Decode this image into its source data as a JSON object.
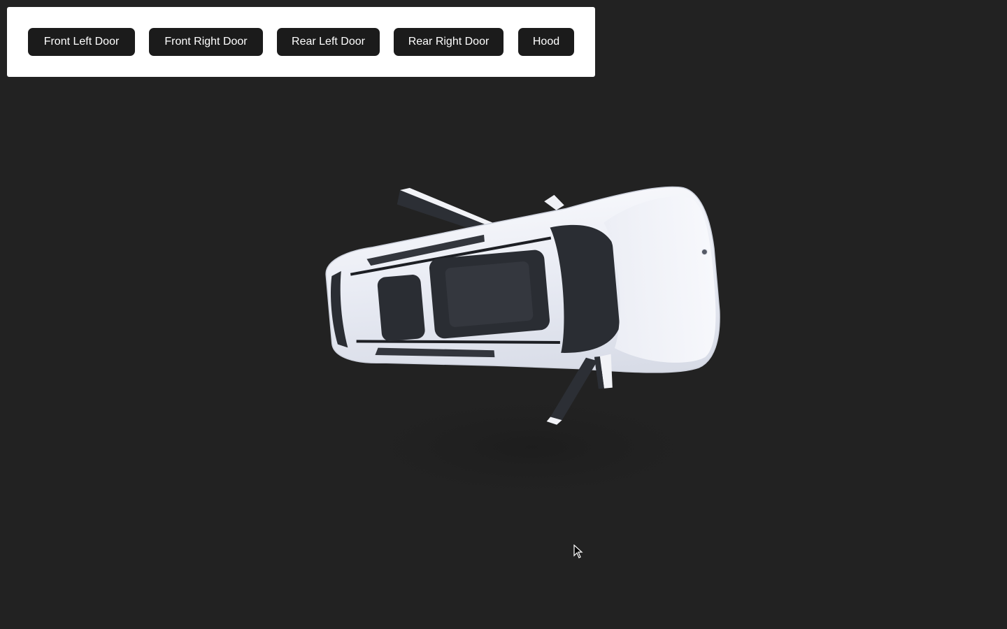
{
  "controls": {
    "buttons": [
      {
        "id": "front_left_door",
        "label": "Front Left Door"
      },
      {
        "id": "front_right_door",
        "label": "Front Right Door"
      },
      {
        "id": "rear_left_door",
        "label": "Rear Left Door"
      },
      {
        "id": "rear_right_door",
        "label": "Rear Right Door"
      },
      {
        "id": "hood",
        "label": "Hood"
      }
    ]
  },
  "scene": {
    "model": "car-3d-viewer",
    "object": "white-suv-top-view",
    "open_parts": [
      "front_left_door",
      "rear_left_door",
      "front_right_door",
      "rear_right_door"
    ],
    "colors": {
      "background": "#222222",
      "panel": "#ffffff",
      "button_bg": "#1b1b1b",
      "button_text": "#ffffff",
      "car_body": "#eef0f6",
      "glass": "#2a2d33"
    }
  },
  "cursor": {
    "icon": "pointer-cursor-icon"
  }
}
